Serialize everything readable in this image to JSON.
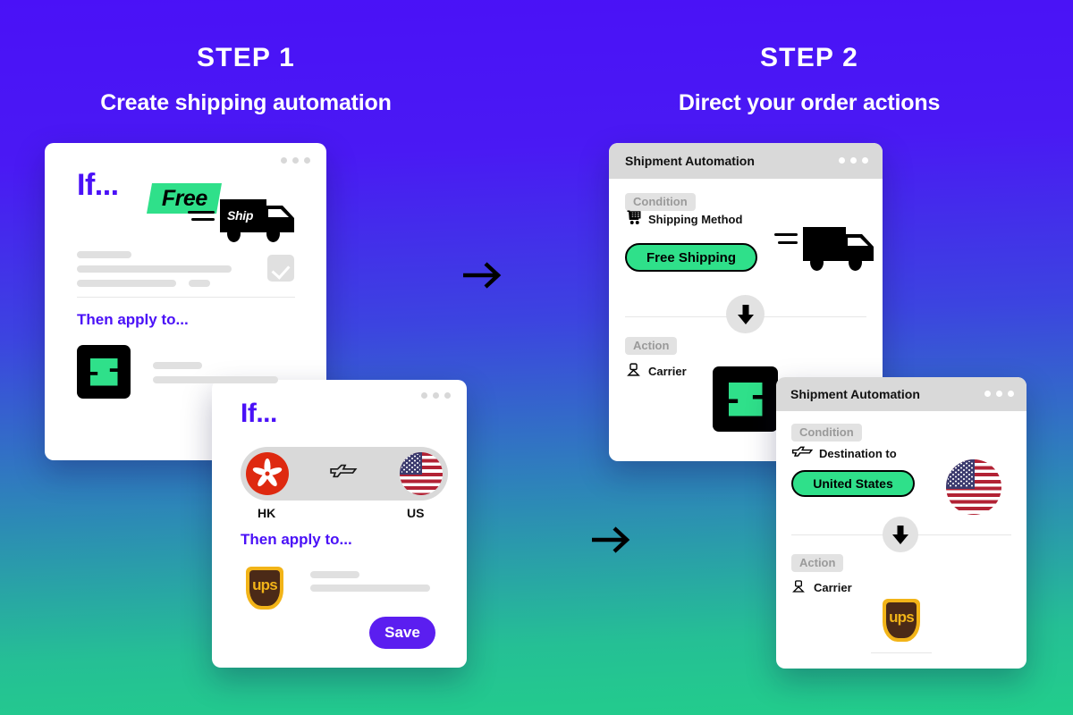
{
  "background": {
    "top_color": "#4a11f7",
    "bottom_color": "#22ce8b"
  },
  "steps": [
    {
      "kicker": "STEP 1",
      "subtitle": "Create shipping automation"
    },
    {
      "kicker": "STEP 2",
      "subtitle": "Direct your order actions"
    }
  ],
  "arrows": {
    "step1_to_step2": "arrow-right",
    "step1b_to_step2b": "arrow-right"
  },
  "card_builder_shipping": {
    "if_label": "If...",
    "free_badge": "Free",
    "truck_label": "Ship",
    "then_label": "Then apply to...",
    "brand_logo": "shipping-brand-logo",
    "checkbox_state": "checked"
  },
  "card_builder_destination": {
    "if_label": "If...",
    "origin_code": "HK",
    "destination_code": "US",
    "origin_flag": "hong-kong-flag",
    "destination_flag": "united-states-flag",
    "transit_icon": "airplane-icon",
    "then_label": "Then apply to...",
    "carrier_logo": "ups-logo",
    "carrier_logo_text": "ups",
    "save_label": "Save"
  },
  "automation_shipping": {
    "window_title": "Shipment Automation",
    "condition_tag": "Condition",
    "condition_icon": "shopping-cart-icon",
    "condition_label": "Shipping Method",
    "condition_value": "Free Shipping",
    "illustration": "delivery-truck-icon",
    "flow_icon": "arrow-down-icon",
    "action_tag": "Action",
    "action_icon": "carrier-person-icon",
    "action_label": "Carrier",
    "action_logo": "shipping-brand-logo"
  },
  "automation_destination": {
    "window_title": "Shipment Automation",
    "condition_tag": "Condition",
    "condition_icon": "airplane-icon",
    "condition_label": "Destination to",
    "condition_value": "United States",
    "illustration": "united-states-flag",
    "flow_icon": "arrow-down-icon",
    "action_tag": "Action",
    "action_icon": "carrier-person-icon",
    "action_label": "Carrier",
    "action_logo": "ups-logo",
    "action_logo_text": "ups"
  },
  "colors": {
    "accent_purple": "#4a11f7",
    "accent_green": "#2fe08a",
    "save_button": "#5b1ef0"
  }
}
